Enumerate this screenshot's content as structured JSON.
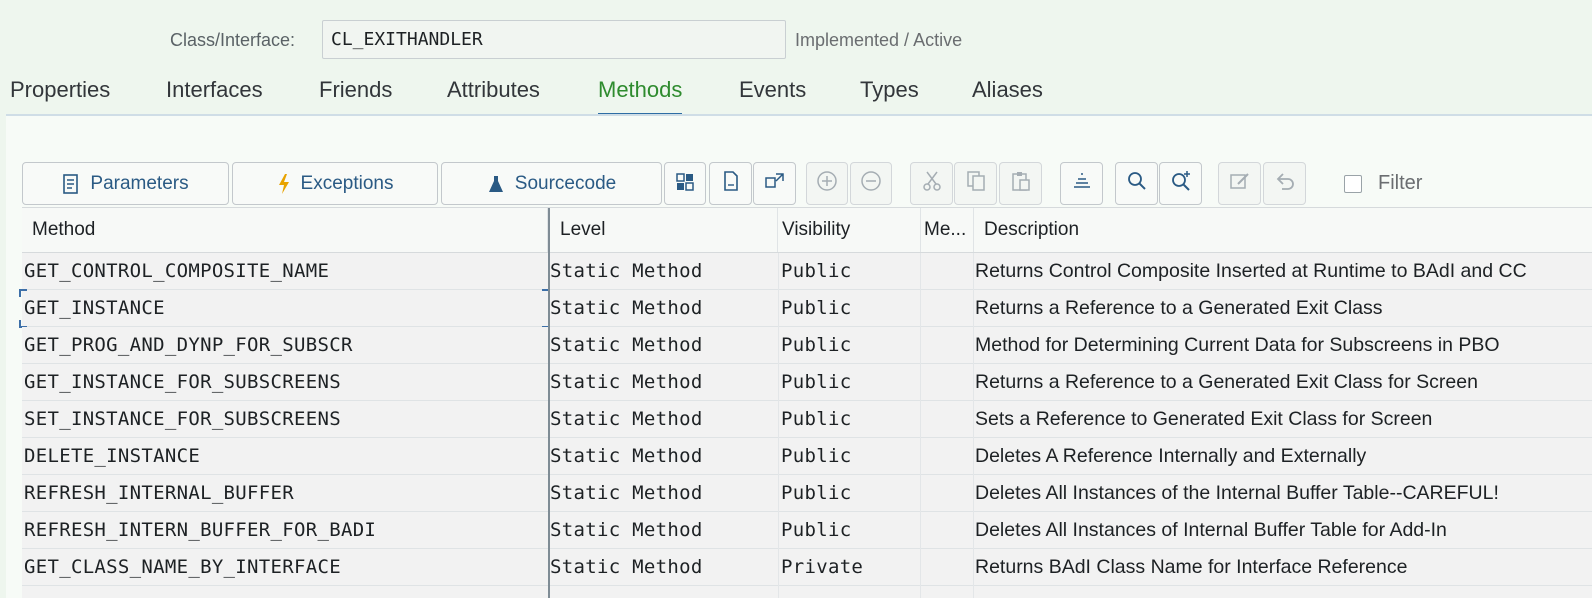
{
  "header": {
    "class_label": "Class/Interface:",
    "class_value": "CL_EXITHANDLER",
    "status": "Implemented / Active"
  },
  "tabs": [
    {
      "label": "Properties"
    },
    {
      "label": "Interfaces"
    },
    {
      "label": "Friends"
    },
    {
      "label": "Attributes"
    },
    {
      "label": "Methods",
      "active": true
    },
    {
      "label": "Events"
    },
    {
      "label": "Types"
    },
    {
      "label": "Aliases"
    }
  ],
  "toolbar": {
    "parameters_label": "Parameters",
    "exceptions_label": "Exceptions",
    "sourcecode_label": "Sourcecode",
    "filter_label": "Filter",
    "icons": [
      "puzzle-icon",
      "document-icon",
      "expand-icon",
      "add-circle-icon",
      "remove-circle-icon",
      "cut-icon",
      "copy-icon",
      "paste-icon",
      "align-icon",
      "search-icon",
      "search-more-icon",
      "edit-icon",
      "undo-icon"
    ]
  },
  "table": {
    "columns": [
      "Method",
      "Level",
      "Visibility",
      "Me...",
      "Description"
    ],
    "rows": [
      {
        "method": "GET_CONTROL_COMPOSITE_NAME",
        "level": "Static Method",
        "visibility": "Public",
        "me": "",
        "description": "Returns Control Composite Inserted at Runtime to BAdI and CC"
      },
      {
        "method": "GET_INSTANCE",
        "level": "Static Method",
        "visibility": "Public",
        "me": "",
        "description": "Returns a Reference to a Generated Exit Class"
      },
      {
        "method": "GET_PROG_AND_DYNP_FOR_SUBSCR",
        "level": "Static Method",
        "visibility": "Public",
        "me": "",
        "description": "Method for Determining Current Data for Subscreens in PBO"
      },
      {
        "method": "GET_INSTANCE_FOR_SUBSCREENS",
        "level": "Static Method",
        "visibility": "Public",
        "me": "",
        "description": "Returns a Reference to a Generated Exit Class for Screen"
      },
      {
        "method": "SET_INSTANCE_FOR_SUBSCREENS",
        "level": "Static Method",
        "visibility": "Public",
        "me": "",
        "description": "Sets a Reference to Generated Exit Class for Screen"
      },
      {
        "method": "DELETE_INSTANCE",
        "level": "Static Method",
        "visibility": "Public",
        "me": "",
        "description": "Deletes A Reference Internally and Externally"
      },
      {
        "method": "REFRESH_INTERNAL_BUFFER",
        "level": "Static Method",
        "visibility": "Public",
        "me": "",
        "description": "Deletes All Instances of the Internal Buffer Table--CAREFUL!"
      },
      {
        "method": "REFRESH_INTERN_BUFFER_FOR_BADI",
        "level": "Static Method",
        "visibility": "Public",
        "me": "",
        "description": "Deletes All Instances of Internal Buffer Table for Add-In"
      },
      {
        "method": "GET_CLASS_NAME_BY_INTERFACE",
        "level": "Static Method",
        "visibility": "Private",
        "me": "",
        "description": "Returns BAdI Class Name for Interface Reference"
      }
    ]
  },
  "colors": {
    "active_tab": "#2e8b2e",
    "tab_underline": "#2e6da4",
    "button_text": "#2a5a84"
  }
}
